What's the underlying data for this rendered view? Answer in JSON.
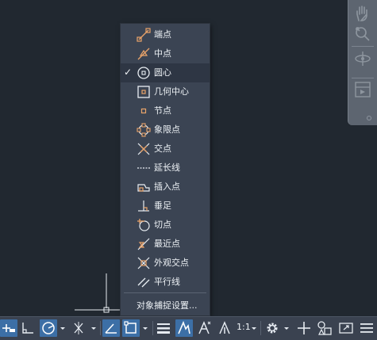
{
  "osnap_menu": {
    "items": [
      {
        "label": "端点",
        "icon": "endpoint-icon",
        "checked": false
      },
      {
        "label": "中点",
        "icon": "midpoint-icon",
        "checked": false
      },
      {
        "label": "圆心",
        "icon": "center-icon",
        "checked": true
      },
      {
        "label": "几何中心",
        "icon": "geometric-center-icon",
        "checked": false
      },
      {
        "label": "节点",
        "icon": "node-icon",
        "checked": false
      },
      {
        "label": "象限点",
        "icon": "quadrant-icon",
        "checked": false
      },
      {
        "label": "交点",
        "icon": "intersection-icon",
        "checked": false
      },
      {
        "label": "延长线",
        "icon": "extension-icon",
        "checked": false
      },
      {
        "label": "插入点",
        "icon": "insertion-icon",
        "checked": false
      },
      {
        "label": "垂足",
        "icon": "perpendicular-icon",
        "checked": false
      },
      {
        "label": "切点",
        "icon": "tangent-icon",
        "checked": false
      },
      {
        "label": "最近点",
        "icon": "nearest-icon",
        "checked": false
      },
      {
        "label": "外观交点",
        "icon": "apparent-intersection-icon",
        "checked": false
      },
      {
        "label": "平行线",
        "icon": "parallel-icon",
        "checked": false
      }
    ],
    "check_mark": "✓",
    "settings_label": "对象捕捉设置..."
  },
  "status_bar": {
    "scale_label": "1:1"
  },
  "colors": {
    "background": "#212830",
    "menu": "#3b4453",
    "icon_orange": "#e9a36a",
    "active_blue": "#3c6fa6"
  }
}
